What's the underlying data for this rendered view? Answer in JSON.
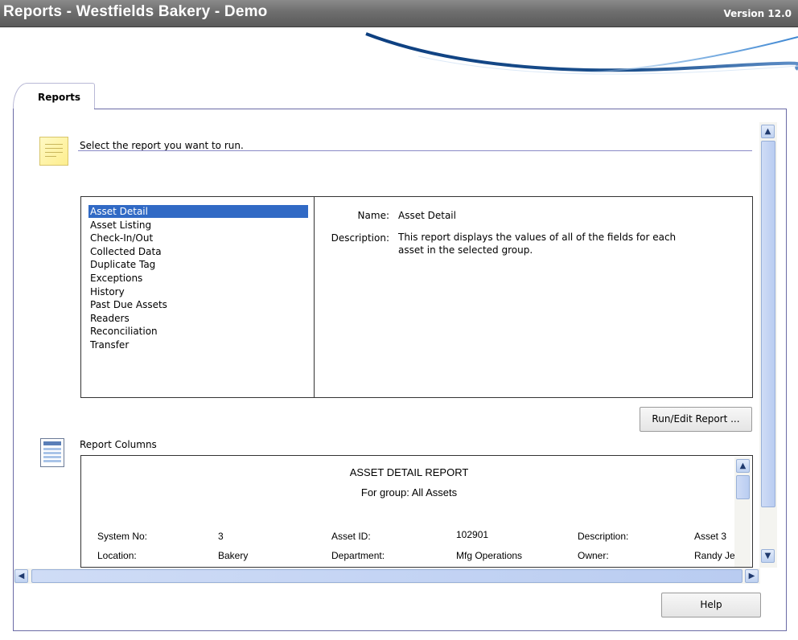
{
  "window": {
    "title": "Reports - Westfields Bakery - Demo",
    "version": "Version 12.0"
  },
  "tabs": [
    {
      "label": "Reports",
      "active": true
    }
  ],
  "select_section": {
    "label": "Select the report you want to run.",
    "icon": "note-icon"
  },
  "reports": {
    "items": [
      "Asset Detail",
      "Asset Listing",
      "Check-In/Out",
      "Collected Data",
      "Duplicate Tag",
      "Exceptions",
      "History",
      "Past Due Assets",
      "Readers",
      "Reconciliation",
      "Transfer"
    ],
    "selected": "Asset Detail"
  },
  "details": {
    "name_label": "Name:",
    "name_value": "Asset Detail",
    "description_label": "Description:",
    "description_line1": "This report displays the values of all of the fields for each",
    "description_line2": "asset in the selected group."
  },
  "buttons": {
    "run_edit": "Run/Edit Report ...",
    "help": "Help"
  },
  "columns_section": {
    "label": "Report Columns",
    "icon": "table-icon"
  },
  "preview": {
    "title": "ASSET DETAIL REPORT",
    "subtitle": "For group: All Assets",
    "rows": [
      [
        {
          "label": "System No:",
          "value": "3"
        },
        {
          "label": "Asset ID:",
          "value": "102901"
        },
        {
          "label": "Description:",
          "value": "Asset 3"
        }
      ],
      [
        {
          "label": "Location:",
          "value": "Bakery"
        },
        {
          "label": "Department:",
          "value": "Mfg Operations"
        },
        {
          "label": "Owner:",
          "value": "Randy Je"
        }
      ]
    ]
  },
  "colors": {
    "titlebar": "#6e6e6e",
    "selection": "#316ac5",
    "panel_border": "#6b6ba6",
    "swoosh": "#1b4f8c"
  }
}
